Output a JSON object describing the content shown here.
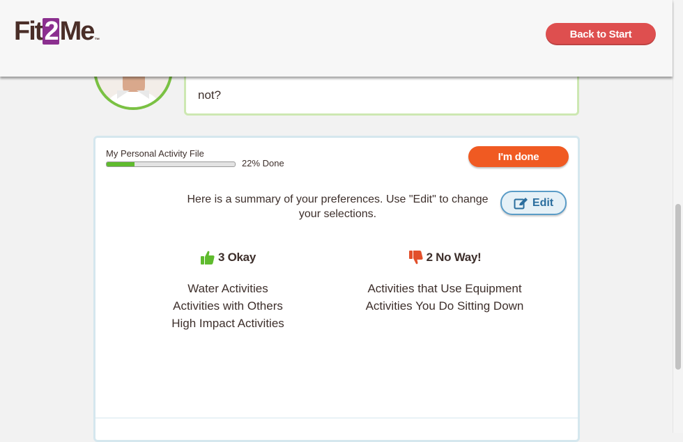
{
  "header": {
    "logo": {
      "part1": "Fit",
      "part2": "2",
      "part3": "Me",
      "tm": "™"
    },
    "back_button": "Back to Start"
  },
  "bubble": {
    "text": "not?"
  },
  "card": {
    "file_label": "My Personal Activity File",
    "progress": {
      "value": 0.22,
      "text": "22% Done"
    },
    "done_button": "I'm done",
    "summary_text": "Here is a summary of your preferences. Use \"Edit\" to change your selections.",
    "edit_button": "Edit",
    "okay": {
      "heading": "3 Okay",
      "icon": "thumbs-up-icon",
      "color": "#5fbb2e",
      "items": [
        "Water Activities",
        "Activities with Others",
        "High Impact Activities"
      ]
    },
    "noway": {
      "heading": "2 No Way!",
      "icon": "thumbs-down-icon",
      "color": "#e2502b",
      "items": [
        "Activities that Use Equipment",
        "Activities You Do Sitting Down"
      ]
    }
  },
  "colors": {
    "brand_purple": "#8b2f8f",
    "back_button": "#de4f4f",
    "done_button": "#f05a22",
    "accent_green": "#7ac143",
    "edit_blue": "#2b6e9e"
  }
}
